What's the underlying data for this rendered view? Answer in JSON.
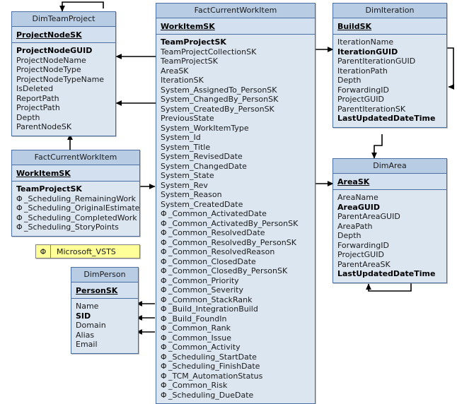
{
  "diagram": {
    "title": "FactCurrentWorkItem star schema",
    "colors": {
      "entity_header": "#b8cce4",
      "entity_key": "#d3e0ef",
      "entity_body": "#dce6f1",
      "entity_border": "#4a6fa5",
      "legend_fill": "#ffff99",
      "legend_border": "#808080",
      "connector": "#000000",
      "canvas": "#ffffff"
    }
  },
  "legend": {
    "symbol": "Φ",
    "label": "Microsoft_VSTS"
  },
  "entities": {
    "dim_team_project": {
      "name": "DimTeamProject",
      "key": "ProjectNodeSK",
      "fields": [
        {
          "text": "ProjectNodeGUID",
          "bold": true,
          "phi": false
        },
        {
          "text": "ProjectNodeName",
          "bold": false,
          "phi": false
        },
        {
          "text": "ProjectNodeType",
          "bold": false,
          "phi": false
        },
        {
          "text": "ProjectNodeTypeName",
          "bold": false,
          "phi": false
        },
        {
          "text": "IsDeleted",
          "bold": false,
          "phi": false
        },
        {
          "text": "ReportPath",
          "bold": false,
          "phi": false
        },
        {
          "text": "ProjectPath",
          "bold": false,
          "phi": false
        },
        {
          "text": "Depth",
          "bold": false,
          "phi": false
        },
        {
          "text": "ParentNodeSK",
          "bold": false,
          "phi": false
        }
      ]
    },
    "fact_current_work_item_left": {
      "name": "FactCurrentWorkItem",
      "key": "WorkItemSK",
      "fields": [
        {
          "text": "TeamProjectSK",
          "bold": true,
          "phi": false
        },
        {
          "text": "_Scheduling_RemainingWork",
          "bold": false,
          "phi": true
        },
        {
          "text": "_Scheduling_OriginalEstimate",
          "bold": false,
          "phi": true
        },
        {
          "text": "_Scheduling_CompletedWork",
          "bold": false,
          "phi": true
        },
        {
          "text": "_Scheduling_StoryPoints",
          "bold": false,
          "phi": true
        }
      ]
    },
    "dim_person": {
      "name": "DimPerson",
      "key": "PersonSK",
      "fields": [
        {
          "text": "Name",
          "bold": false,
          "phi": false
        },
        {
          "text": "SID",
          "bold": true,
          "phi": false
        },
        {
          "text": "Domain",
          "bold": false,
          "phi": false
        },
        {
          "text": "Alias",
          "bold": false,
          "phi": false
        },
        {
          "text": "Email",
          "bold": false,
          "phi": false
        }
      ]
    },
    "fact_current_work_item_main": {
      "name": "FactCurrentWorkItem",
      "key": "WorkItemSK",
      "fields": [
        {
          "text": "TeamProjectSK",
          "bold": true,
          "phi": false
        },
        {
          "text": "TeamProjectCollectionSK",
          "bold": false,
          "phi": false
        },
        {
          "text": "TeamProjectSK",
          "bold": false,
          "phi": false
        },
        {
          "text": "AreaSK",
          "bold": false,
          "phi": false
        },
        {
          "text": "IterationSK",
          "bold": false,
          "phi": false
        },
        {
          "text": "System_AssignedTo_PersonSK",
          "bold": false,
          "phi": false
        },
        {
          "text": "System_ChangedBy_PersonSK",
          "bold": false,
          "phi": false
        },
        {
          "text": "System_CreatedBy_PersonSK",
          "bold": false,
          "phi": false
        },
        {
          "text": "PreviousState",
          "bold": false,
          "phi": false
        },
        {
          "text": "System_WorkItemType",
          "bold": false,
          "phi": false
        },
        {
          "text": "System_Id",
          "bold": false,
          "phi": false
        },
        {
          "text": "System_Title",
          "bold": false,
          "phi": false
        },
        {
          "text": "System_RevisedDate",
          "bold": false,
          "phi": false
        },
        {
          "text": "System_ChangedDate",
          "bold": false,
          "phi": false
        },
        {
          "text": "System_State",
          "bold": false,
          "phi": false
        },
        {
          "text": "System_Rev",
          "bold": false,
          "phi": false
        },
        {
          "text": "System_Reason",
          "bold": false,
          "phi": false
        },
        {
          "text": "System_CreatedDate",
          "bold": false,
          "phi": false
        },
        {
          "text": "_Common_ActivatedDate",
          "bold": false,
          "phi": true
        },
        {
          "text": "_Common_ActivatedBy_PersonSK",
          "bold": false,
          "phi": true
        },
        {
          "text": "_Common_ResolvedDate",
          "bold": false,
          "phi": true
        },
        {
          "text": "_Common_ResolvedBy_PersonSK",
          "bold": false,
          "phi": true
        },
        {
          "text": "_Common_ResolvedReason",
          "bold": false,
          "phi": true
        },
        {
          "text": "_Common_ClosedDate",
          "bold": false,
          "phi": true
        },
        {
          "text": "_Common_ClosedBy_PersonSK",
          "bold": false,
          "phi": true
        },
        {
          "text": "_Common_Priority",
          "bold": false,
          "phi": true
        },
        {
          "text": "_Common_Severity",
          "bold": false,
          "phi": true
        },
        {
          "text": "_Common_StackRank",
          "bold": false,
          "phi": true
        },
        {
          "text": "_Build_IntegrationBuild",
          "bold": false,
          "phi": true
        },
        {
          "text": "_Build_FoundIn",
          "bold": false,
          "phi": true
        },
        {
          "text": "_Common_Rank",
          "bold": false,
          "phi": true
        },
        {
          "text": "_Common_Issue",
          "bold": false,
          "phi": true
        },
        {
          "text": "_Common_Activity",
          "bold": false,
          "phi": true
        },
        {
          "text": "_Scheduling_StartDate",
          "bold": false,
          "phi": true
        },
        {
          "text": "_Scheduling_FinishDate",
          "bold": false,
          "phi": true
        },
        {
          "text": "_TCM_AutomationStatus",
          "bold": false,
          "phi": true
        },
        {
          "text": "_Common_Risk",
          "bold": false,
          "phi": true
        },
        {
          "text": "_Scheduling_DueDate",
          "bold": false,
          "phi": true
        }
      ]
    },
    "dim_iteration": {
      "name": "DimIteration",
      "key": "BuildSK",
      "fields": [
        {
          "text": "IterationName",
          "bold": false,
          "phi": false
        },
        {
          "text": "IterationGUID",
          "bold": true,
          "phi": false
        },
        {
          "text": "ParentIterationGUID",
          "bold": false,
          "phi": false
        },
        {
          "text": "IterationPath",
          "bold": false,
          "phi": false
        },
        {
          "text": "Depth",
          "bold": false,
          "phi": false
        },
        {
          "text": "ForwardingID",
          "bold": false,
          "phi": false
        },
        {
          "text": "ProjectGUID",
          "bold": false,
          "phi": false
        },
        {
          "text": "ParentIterationSK",
          "bold": false,
          "phi": false
        },
        {
          "text": "LastUpdatedDateTime",
          "bold": true,
          "phi": false
        }
      ]
    },
    "dim_area": {
      "name": "DimArea",
      "key": "AreaSK",
      "fields": [
        {
          "text": "AreaName",
          "bold": false,
          "phi": false
        },
        {
          "text": "AreaGUID",
          "bold": true,
          "phi": false
        },
        {
          "text": "ParentAreaGUID",
          "bold": false,
          "phi": false
        },
        {
          "text": "AreaPath",
          "bold": false,
          "phi": false
        },
        {
          "text": "Depth",
          "bold": false,
          "phi": false
        },
        {
          "text": "ForwardingID",
          "bold": false,
          "phi": false
        },
        {
          "text": "ProjectGUID",
          "bold": false,
          "phi": false
        },
        {
          "text": "ParentAreaSK",
          "bold": false,
          "phi": false
        },
        {
          "text": "LastUpdatedDateTime",
          "bold": true,
          "phi": false
        }
      ]
    }
  }
}
